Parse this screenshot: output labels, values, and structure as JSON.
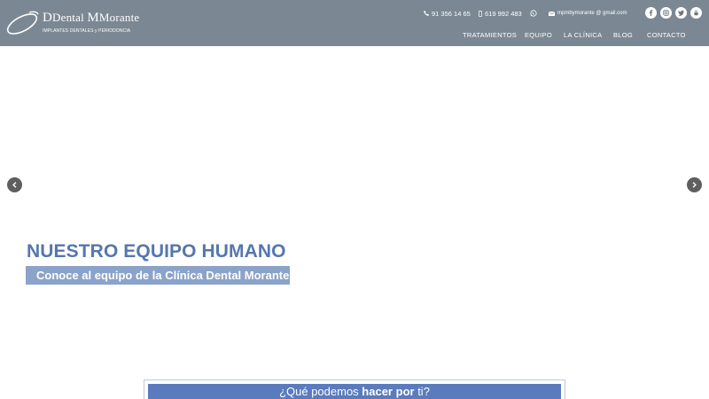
{
  "brand": {
    "name_first": "Dental",
    "name_second": "Morante",
    "tagline": "IMPLANTES DENTALES y PERIODONCIA"
  },
  "contact": {
    "phone": "91 356 14 65",
    "mobile": "619 992 483",
    "email": "mpmbymorante @ gmail.com"
  },
  "social": [
    "facebook-icon",
    "instagram-icon",
    "twitter-icon",
    "youtube-icon"
  ],
  "nav": {
    "items": [
      "TRATAMIENTOS",
      "EQUIPO",
      "LA CLÍNICA",
      "BLOG",
      "CONTACTO"
    ]
  },
  "hero": {
    "title": "NUESTRO EQUIPO HUMANO",
    "subtitle": "Conoce al equipo de la Clínica Dental Morante"
  },
  "help": {
    "prefix": "¿Qué podemos ",
    "bold1": "hacer",
    "space": " ",
    "bold2": "por",
    "suffix": " ti?"
  },
  "colors": {
    "header_bg": "#7b8893",
    "hero_title": "#5577ad",
    "hero_sub_bg": "#8ba3c9",
    "help_bg": "#5a7bbd"
  }
}
